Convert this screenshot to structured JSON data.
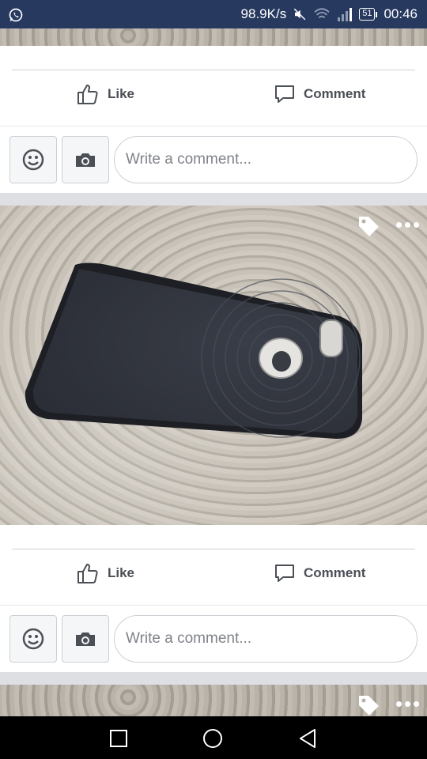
{
  "status_bar": {
    "network_speed": "98.9K/s",
    "battery": "51",
    "time": "00:46",
    "bg_color": "#27395f",
    "icons": [
      "whatsapp-icon",
      "mute-icon",
      "wifi-icon",
      "signal-icon",
      "battery-icon"
    ]
  },
  "posts": [
    {
      "like_label": "Like",
      "comment_label": "Comment",
      "comment_placeholder": "Write a comment..."
    },
    {
      "like_label": "Like",
      "comment_label": "Comment",
      "comment_placeholder": "Write a comment..."
    }
  ],
  "photo_icons": [
    "tag-icon",
    "more-options-icon"
  ],
  "nav_bar": {
    "buttons": [
      "recents-icon",
      "home-icon",
      "back-icon"
    ]
  }
}
